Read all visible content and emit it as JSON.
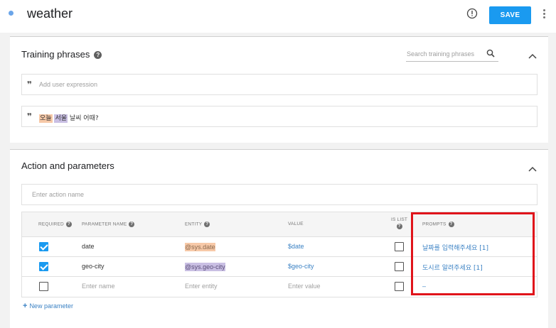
{
  "header": {
    "intent_title": "weather",
    "save_label": "SAVE"
  },
  "training": {
    "section_title": "Training phrases",
    "search_placeholder": "Search training phrases",
    "add_placeholder": "Add user expression",
    "phrase": {
      "date_word": "오늘",
      "city_word": "서울",
      "rest": " 날씨 어때?"
    }
  },
  "action": {
    "section_title": "Action and parameters",
    "action_placeholder": "Enter action name",
    "columns": {
      "required": "REQUIRED",
      "name": "PARAMETER NAME",
      "entity": "ENTITY",
      "value": "VALUE",
      "is_list": "IS LIST",
      "prompts": "PROMPTS"
    },
    "rows": [
      {
        "required": true,
        "name": "date",
        "entity": "@sys.date",
        "value": "$date",
        "is_list": false,
        "prompt": "날짜를 입력해주세요 [1]"
      },
      {
        "required": true,
        "name": "geo-city",
        "entity": "@sys.geo-city",
        "value": "$geo-city",
        "is_list": false,
        "prompt": "도시르 알려주세요 [1]"
      }
    ],
    "empty_row": {
      "name_placeholder": "Enter name",
      "entity_placeholder": "Enter entity",
      "value_placeholder": "Enter value",
      "prompt_placeholder": "–"
    },
    "new_parameter_label": "New parameter"
  },
  "colors": {
    "accent": "#1a9af0",
    "date_highlight": "#f7c9a8",
    "city_highlight": "#c9bfe3",
    "annotation_box": "#e0141b",
    "link": "#3b82c4"
  },
  "icons": [
    "alert-circle-icon",
    "more-vert-icon",
    "help-icon",
    "search-icon",
    "chevron-up-icon",
    "quote-icon",
    "checkbox-icon",
    "plus-icon"
  ]
}
